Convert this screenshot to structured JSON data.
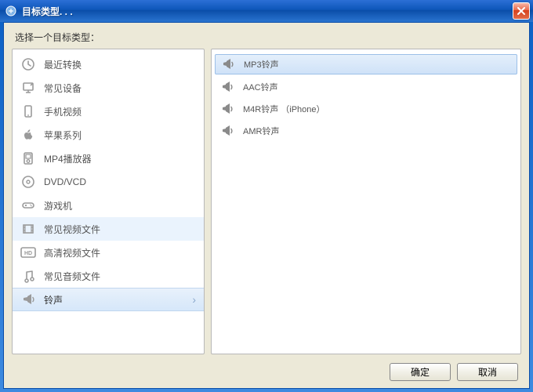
{
  "window": {
    "title": "目标类型. . ."
  },
  "instruction": "选择一个目标类型：",
  "categories": [
    {
      "id": "recent",
      "label": "最近转换",
      "icon": "clock-icon"
    },
    {
      "id": "devices",
      "label": "常见设备",
      "icon": "device-icon"
    },
    {
      "id": "mobile",
      "label": "手机视频",
      "icon": "phone-icon"
    },
    {
      "id": "apple",
      "label": "苹果系列",
      "icon": "apple-icon"
    },
    {
      "id": "mp4",
      "label": "MP4播放器",
      "icon": "player-icon"
    },
    {
      "id": "dvd",
      "label": "DVD/VCD",
      "icon": "disc-icon"
    },
    {
      "id": "game",
      "label": "游戏机",
      "icon": "gamepad-icon"
    },
    {
      "id": "video",
      "label": "常见视频文件",
      "icon": "film-icon"
    },
    {
      "id": "hd",
      "label": "高清视频文件",
      "icon": "hd-icon"
    },
    {
      "id": "audio",
      "label": "常见音频文件",
      "icon": "music-icon"
    },
    {
      "id": "ringtone",
      "label": "铃声",
      "icon": "ringtone-icon"
    }
  ],
  "selected_category_index": 10,
  "hover_category_index": 7,
  "formats": [
    {
      "label": "MP3铃声"
    },
    {
      "label": "AAC铃声"
    },
    {
      "label": "M4R铃声 （iPhone）"
    },
    {
      "label": "AMR铃声"
    }
  ],
  "selected_format_index": 0,
  "buttons": {
    "ok": "确定",
    "cancel": "取消"
  }
}
